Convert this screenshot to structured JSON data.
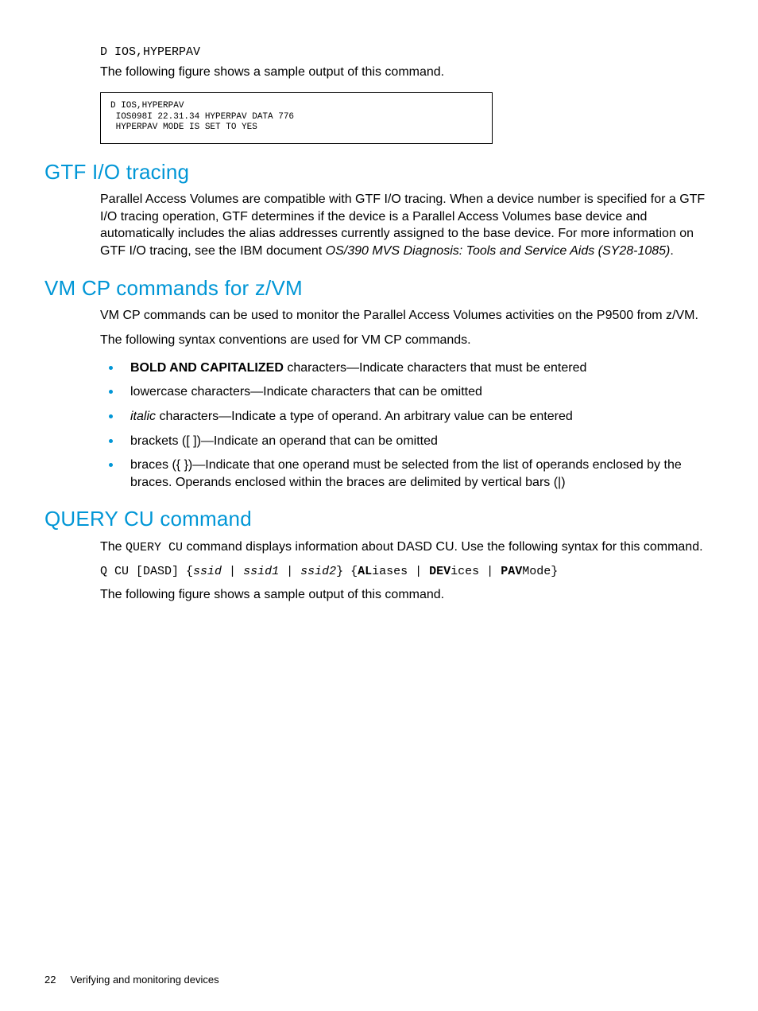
{
  "intro": {
    "cmd": "D IOS,HYPERPAV",
    "caption": "The following figure shows a sample output of this command.",
    "figure": "D IOS,HYPERPAV\n IOS098I 22.31.34 HYPERPAV DATA 776\n HYPERPAV MODE IS SET TO YES"
  },
  "gtf": {
    "heading": "GTF I/O tracing",
    "para_a": "Parallel Access Volumes are compatible with GTF I/O tracing. When a device number is specified for a GTF I/O tracing operation, GTF determines if the device is a Parallel Access Volumes base device and automatically includes the alias addresses currently assigned to the base device. For more information on GTF I/O tracing, see the IBM document ",
    "para_ref": "OS/390 MVS Diagnosis: Tools and Service Aids (SY28-1085)",
    "para_b": "."
  },
  "vmcp": {
    "heading": "VM CP commands for z/VM",
    "p1": "VM CP commands can be used to monitor the Parallel Access Volumes activities on the P9500 from z/VM.",
    "p2": "The following syntax conventions are used for VM CP commands.",
    "items": {
      "b0a": "BOLD AND CAPITALIZED",
      "b0b": " characters—Indicate characters that must be entered",
      "b1": "lowercase characters—Indicate characters that can be omitted",
      "b2a": "italic",
      "b2b": " characters—Indicate a type of operand. An arbitrary value can be entered",
      "b3": "brackets ([ ])—Indicate an operand that can be omitted",
      "b4": "braces ({ })—Indicate that one operand must be selected from the list of operands enclosed by the braces. Operands enclosed within the braces are delimited by vertical bars (|)"
    }
  },
  "query": {
    "heading": "QUERY CU command",
    "p1a": "The ",
    "p1code": "QUERY CU",
    "p1b": " command displays information about DASD CU. Use the following syntax for this command.",
    "syntax": {
      "s0": "Q CU [DASD] {",
      "s1": "ssid",
      "s2": " | ",
      "s3": "ssid1",
      "s4": " | ",
      "s5": "ssid2",
      "s6": "} {",
      "s7": "AL",
      "s8": "iases | ",
      "s9": "DEV",
      "s10": "ices | ",
      "s11": "PAV",
      "s12": "Mode}"
    },
    "p2": "The following figure shows a sample output of this command."
  },
  "footer": {
    "page": "22",
    "section": "Verifying and monitoring devices"
  }
}
